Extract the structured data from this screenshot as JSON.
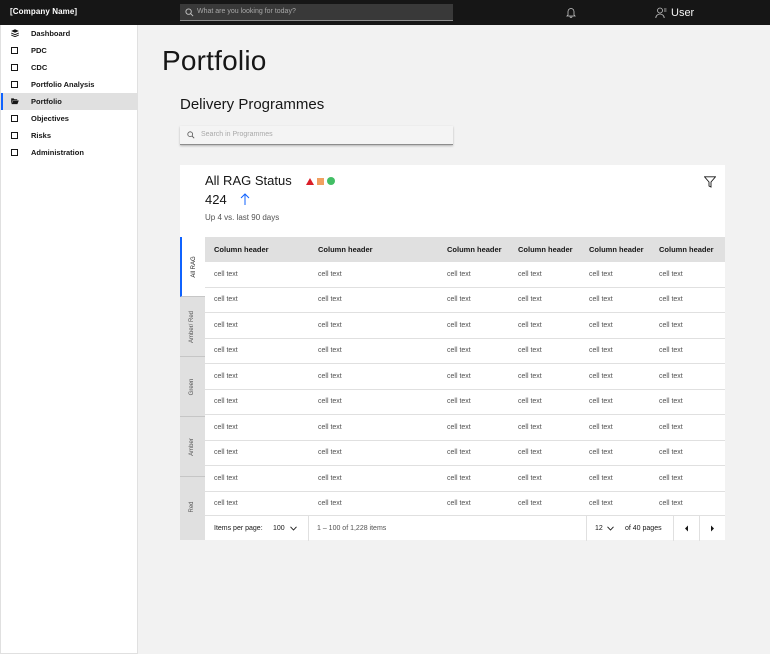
{
  "header": {
    "company": "[Company Name]",
    "search_placeholder": "What are you looking for today?",
    "user_label": "User"
  },
  "sidebar": {
    "items": [
      {
        "label": "Dashboard",
        "icon": "layers-icon"
      },
      {
        "label": "PDC",
        "icon": "checkbox-icon"
      },
      {
        "label": "CDC",
        "icon": "checkbox-icon"
      },
      {
        "label": "Portfolio Analysis",
        "icon": "checkbox-icon"
      },
      {
        "label": "Portfolio",
        "icon": "folder-open-icon",
        "active": true
      },
      {
        "label": "Objectives",
        "icon": "checkbox-icon"
      },
      {
        "label": "Risks",
        "icon": "checkbox-icon"
      },
      {
        "label": "Administration",
        "icon": "checkbox-icon"
      }
    ]
  },
  "main": {
    "page_title": "Portfolio",
    "section_title": "Delivery Programmes",
    "search_placeholder": "Search in Programmes"
  },
  "card": {
    "title": "All RAG Status",
    "count": "424",
    "delta": "Up 4 vs. last 90 days",
    "rag_colors": {
      "red": "#da1e28",
      "amber": "#f1a060",
      "green": "#42be65"
    },
    "tabs": [
      {
        "label": "All RAG",
        "active": true
      },
      {
        "label": "Amber/ Red"
      },
      {
        "label": "Green"
      },
      {
        "label": "Amber"
      },
      {
        "label": "Red"
      }
    ]
  },
  "table": {
    "headers": [
      "Column header",
      "Column header",
      "Column header",
      "Column header",
      "Column header",
      "Column header"
    ],
    "rows": [
      [
        "cell text",
        "cell text",
        "cell text",
        "cell text",
        "cell text",
        "cell text"
      ],
      [
        "cell text",
        "cell text",
        "cell text",
        "cell text",
        "cell text",
        "cell text"
      ],
      [
        "cell text",
        "cell text",
        "cell text",
        "cell text",
        "cell text",
        "cell text"
      ],
      [
        "cell text",
        "cell text",
        "cell text",
        "cell text",
        "cell text",
        "cell text"
      ],
      [
        "cell text",
        "cell text",
        "cell text",
        "cell text",
        "cell text",
        "cell text"
      ],
      [
        "cell text",
        "cell text",
        "cell text",
        "cell text",
        "cell text",
        "cell text"
      ],
      [
        "cell text",
        "cell text",
        "cell text",
        "cell text",
        "cell text",
        "cell text"
      ],
      [
        "cell text",
        "cell text",
        "cell text",
        "cell text",
        "cell text",
        "cell text"
      ],
      [
        "cell text",
        "cell text",
        "cell text",
        "cell text",
        "cell text",
        "cell text"
      ],
      [
        "cell text",
        "cell text",
        "cell text",
        "cell text",
        "cell text",
        "cell text"
      ]
    ]
  },
  "pagination": {
    "items_per_page_label": "Items per page:",
    "items_per_page_value": "100",
    "range": "1 – 100 of 1,228 items",
    "page": "12",
    "of_pages": "of 40 pages"
  },
  "accent_color": "#0f62fe"
}
